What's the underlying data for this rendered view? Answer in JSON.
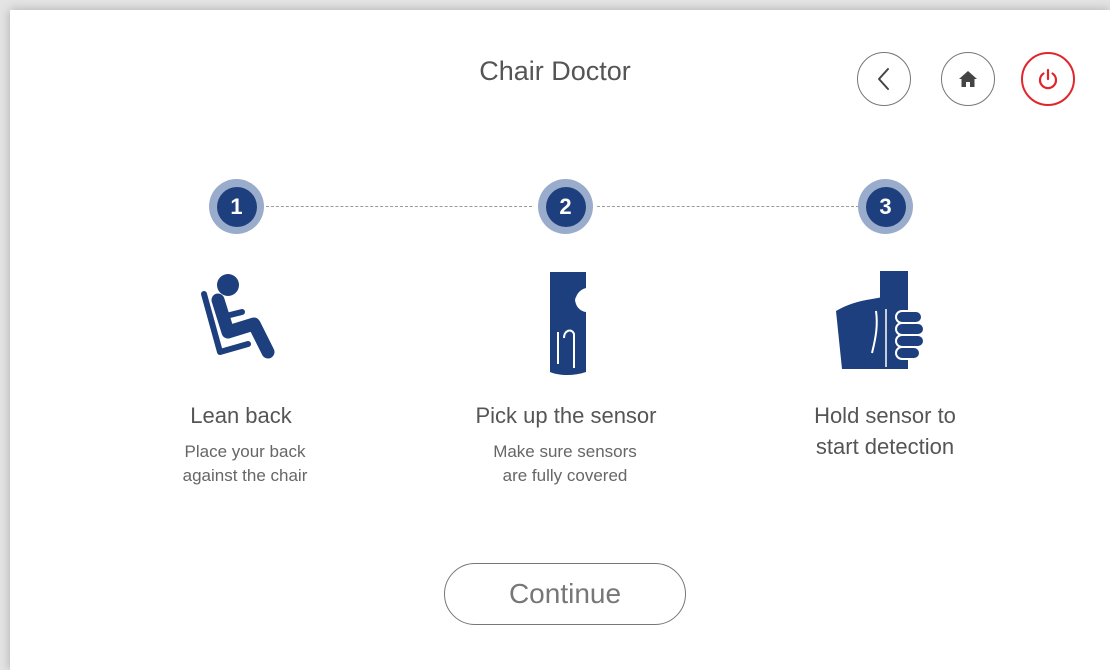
{
  "header": {
    "title": "Chair Doctor",
    "back_icon": "chevron-left-icon",
    "home_icon": "home-icon",
    "power_icon": "power-icon",
    "power_color": "#e0262b"
  },
  "steps": [
    {
      "number": "1",
      "icon": "recline-person-icon",
      "title": "Lean back",
      "description_line1": "Place your back",
      "description_line2": "against the chair"
    },
    {
      "number": "2",
      "icon": "sensor-icon",
      "title": "Pick up the sensor",
      "description_line1": "Make sure sensors",
      "description_line2": "are fully covered"
    },
    {
      "number": "3",
      "icon": "hand-holding-sensor-icon",
      "title_line1": "Hold sensor to",
      "title_line2": "start detection"
    }
  ],
  "colors": {
    "accent": "#1e3f7d",
    "step_ring": "#9aaccb"
  },
  "continue_label": "Continue"
}
